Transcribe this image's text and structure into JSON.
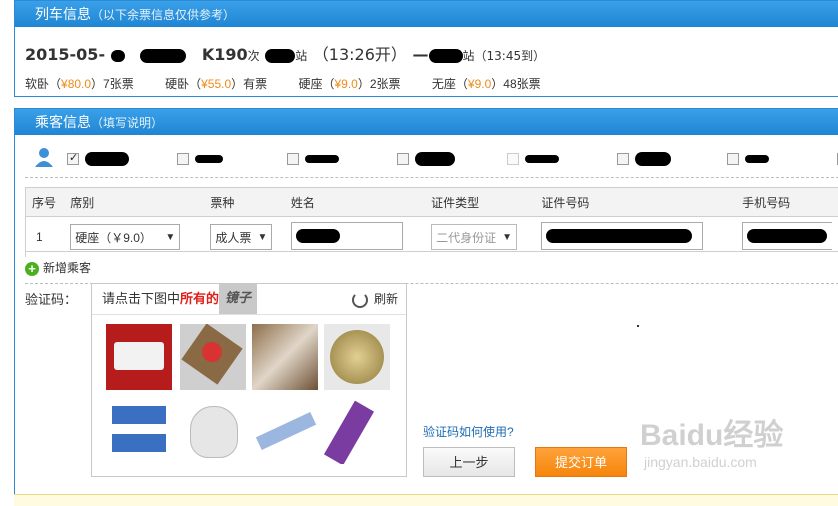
{
  "train_panel": {
    "title": "列车信息",
    "subtitle": "（以下余票信息仅供参考）",
    "date": "2015-05-",
    "train_no": "K190",
    "ci": "次",
    "dep_suffix": "站",
    "dep_time": "（13:26开）",
    "dash": "—",
    "arr_suffix": "站",
    "arr_time": "（13:45到）",
    "seats": [
      {
        "name": "软卧（",
        "price": "¥80.0",
        "rest": "）7张票"
      },
      {
        "name": "硬卧（",
        "price": "¥55.0",
        "rest": "）有票"
      },
      {
        "name": "硬座（",
        "price": "¥9.0",
        "rest": "）2张票"
      },
      {
        "name": "无座（",
        "price": "¥9.0",
        "rest": "）48张票"
      }
    ]
  },
  "passenger_panel": {
    "title": "乘客信息",
    "subtitle": "（填写说明）",
    "headers": [
      "序号",
      "席别",
      "票种",
      "姓名",
      "证件类型",
      "证件号码",
      "手机号码"
    ],
    "row": {
      "index": "1",
      "seat": "硬座（￥9.0）",
      "ticket": "成人票",
      "id_type": "二代身份证"
    },
    "add_passenger": "新增乘客"
  },
  "captcha": {
    "label": "验证码：",
    "prompt_pre": "请点击下图中",
    "prompt_em": "所有的",
    "prompt_word": "镜子",
    "refresh": "刷新",
    "help": "验证码如何使用?"
  },
  "buttons": {
    "prev": "上一步",
    "submit": "提交订单"
  },
  "watermark": {
    "brand": "Baidu经验",
    "url": "jingyan.baidu.com"
  }
}
